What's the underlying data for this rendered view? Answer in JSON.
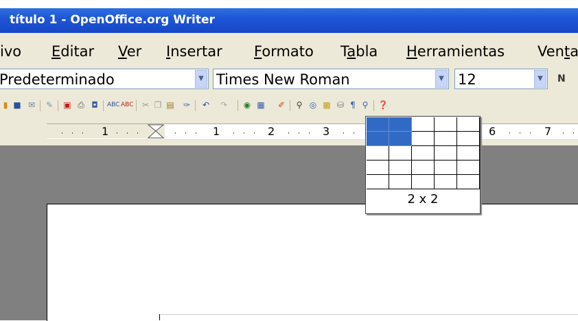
{
  "window": {
    "title": "título 1 - OpenOffice.org Writer"
  },
  "menu": [
    {
      "label": "ivo",
      "underline": ""
    },
    {
      "label": "ditar",
      "underline": "E"
    },
    {
      "label": "er",
      "underline": "V"
    },
    {
      "label": "nsertar",
      "underline": "I"
    },
    {
      "label": "ormato",
      "underline": "F"
    },
    {
      "label": "T",
      "underline": "a",
      "rest": "bla"
    },
    {
      "label": "erramientas",
      "underline": "H"
    },
    {
      "label": "Ven",
      "underline": "t",
      "rest": "a"
    }
  ],
  "format_bar": {
    "style": "Predeterminado",
    "font": "Times New Roman",
    "size": "12",
    "bold": "N"
  },
  "ruler": {
    "numbers": [
      "1",
      "1",
      "2",
      "3",
      "6",
      "7"
    ]
  },
  "table_picker": {
    "rows": 5,
    "cols": 5,
    "selected_rows": 2,
    "selected_cols": 2,
    "label": "2 x 2"
  },
  "icons": [
    "new-icon",
    "save-icon",
    "email-icon",
    "edit-icon",
    "pdf-icon",
    "print-icon",
    "preview-icon",
    "spellcheck-icon",
    "autospell-icon",
    "cut-icon",
    "copy-icon",
    "paste-icon",
    "format-paint-icon",
    "undo-icon",
    "redo-icon",
    "hyperlink-icon",
    "table-icon",
    "draw-icon",
    "find-icon",
    "navigator-icon",
    "gallery-icon",
    "datasource-icon",
    "pilcrow-icon",
    "zoom-icon",
    "help-icon"
  ]
}
